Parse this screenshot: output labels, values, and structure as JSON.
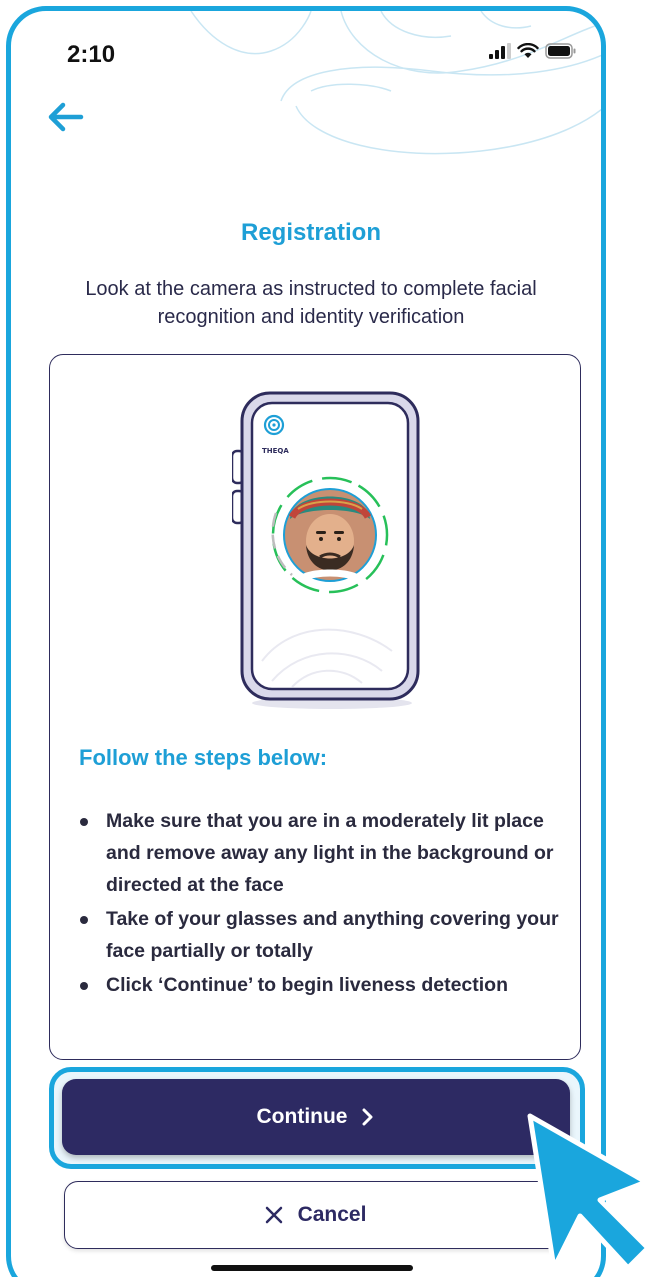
{
  "status_bar": {
    "time": "2:10"
  },
  "header": {
    "back_icon": "arrow-left-icon"
  },
  "title": "Registration",
  "subtitle": "Look at the camera as instructed to complete facial recognition and identity verification",
  "illustration": {
    "logo_icon": "fingerprint-icon",
    "logo_text": "THEQA"
  },
  "steps": {
    "heading": "Follow the steps below:",
    "items": [
      "Make sure that you are in a moderately lit place and remove away any light in the background or directed at the face",
      "Take of your glasses and anything covering your face partially or totally",
      "Click ‘Continue’ to begin liveness detection"
    ]
  },
  "buttons": {
    "continue_label": "Continue",
    "continue_icon": "chevron-right-icon",
    "cancel_label": "Cancel",
    "cancel_icon": "close-icon"
  },
  "colors": {
    "accent": "#1e9fd6",
    "primary_dark": "#2d2a63",
    "frame": "#1aa6dd"
  }
}
